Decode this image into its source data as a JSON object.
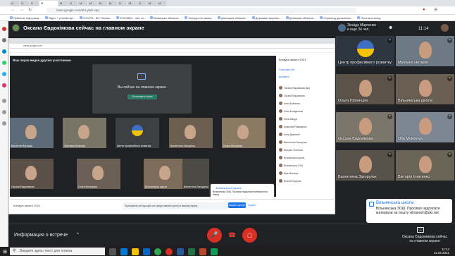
{
  "browser": {
    "tabs": [
      {
        "label": "G"
      },
      {
        "label": "G"
      },
      {
        "label": "G"
      },
      {
        "label": "M"
      },
      {
        "label": "M"
      },
      {
        "label": "G"
      },
      {
        "label": "M"
      },
      {
        "label": "M"
      },
      {
        "label": "M"
      },
      {
        "label": "M"
      },
      {
        "label": "B"
      },
      {
        "label": "M"
      },
      {
        "label": "G"
      },
      {
        "label": "M"
      },
      {
        "label": "M"
      }
    ],
    "url": "meet.google.com/hhi-ybdr-vpa",
    "bookmarks": [
      "Публічна інформац...",
      "Відео + presidentpl...",
      "OSVITA - ВО Темник...",
      "ЄЛОФКІН - звіт та...",
      "Вінницька обласна...",
      "Конкурс на заміщ...",
      "Донецька обласна...",
      "Державні закупівл...",
      "Донецька обласна...",
      "Оприлюд державних...",
      "Протокол-пред..."
    ]
  },
  "meet": {
    "presenting_title": "Оксана Євдокімова сейчас на главном экране",
    "shared_screen": {
      "url": "meet.google.com",
      "banner": "Ваш экран виден другим участникам",
      "presenting_text": "Вы сейчас на главном экране",
      "stop_button": "Остановить показ",
      "tiles": [
        "Валентин Мутакас",
        "Світлана Юганова",
        "Центр професійного розвитку",
        "Валентина Загорульк",
        "Ольга Молокова",
        "Оксана Євдокимова",
        "Ольга Молокова",
        "Вільнянська школа",
        "Валентина Загорульк"
      ],
      "side_header": "Конкурс-захист 2021",
      "side_people": "Участники (44)",
      "side_add": "Добавить",
      "side_list": [
        "Оксана Євдокімова (вы)",
        "Оксана Євдокімова",
        "Алла Бойчинко",
        "Алла Бондаренко",
        "Анна Мащук",
        "Анжеліка Ромащенко",
        "Анна Дешевий",
        "Валентина Загорульк",
        "Вікторія Ігнатенко",
        "Вільнянська школа",
        "Вільнянська СЗШ",
        "Віра Маньчук",
        "Віталій Подоляк"
      ],
      "notice_title": "Вільнянська школа",
      "notice_msg": "Вільнянська ЗОШ. Просимо надсилати матеріали на пошту.",
      "bottom_label": "Конкурс-захист 2021",
      "share_bar": "Приложение meet.google.com предоставляет доступ к вашему экрану",
      "share_button": "Закрыть доступ",
      "hide_button": "Скрыть"
    },
    "right_header": {
      "name_line1": "Зінаїда Марченко",
      "name_line2": "и еще 34 чел.",
      "time": "11:14"
    },
    "participants": [
      {
        "name": "Центр професійного розвитку",
        "muted": true
      },
      {
        "name": "Мунішко Наталія",
        "muted": true
      },
      {
        "name": "Ольга Поленцюк",
        "muted": true
      },
      {
        "name": "Вільнянська школа",
        "muted": true
      },
      {
        "name": "Оксана Євдокімова",
        "muted": true
      },
      {
        "name": "Olla Molokova",
        "muted": true
      },
      {
        "name": "Валентина Загорульк",
        "muted": true
      },
      {
        "name": "Вікторія Ігнатенко",
        "muted": true
      }
    ],
    "notification": {
      "title": "Вільнянська школа",
      "message": "Вільнянська ЗОШ. Просимо надсилати матеріали на пошту vilnaoosh@ukr.net"
    },
    "controls": {
      "meeting_info": "Информация о встрече",
      "caret": "^",
      "cc_label": "CC",
      "present_label": "Оксана Євдокимова сейчас на главном экране",
      "mic_icon": "mic-off-icon",
      "hangup_icon": "hangup-icon",
      "camera_icon": "camera-off-icon",
      "mic_color": "#d93025",
      "hangup_color": "#202124",
      "camera_color": "#d93025"
    }
  },
  "taskbar": {
    "search_placeholder": "Введите здесь текст для поиска",
    "time": "11:14",
    "date": "11.02.2021"
  }
}
